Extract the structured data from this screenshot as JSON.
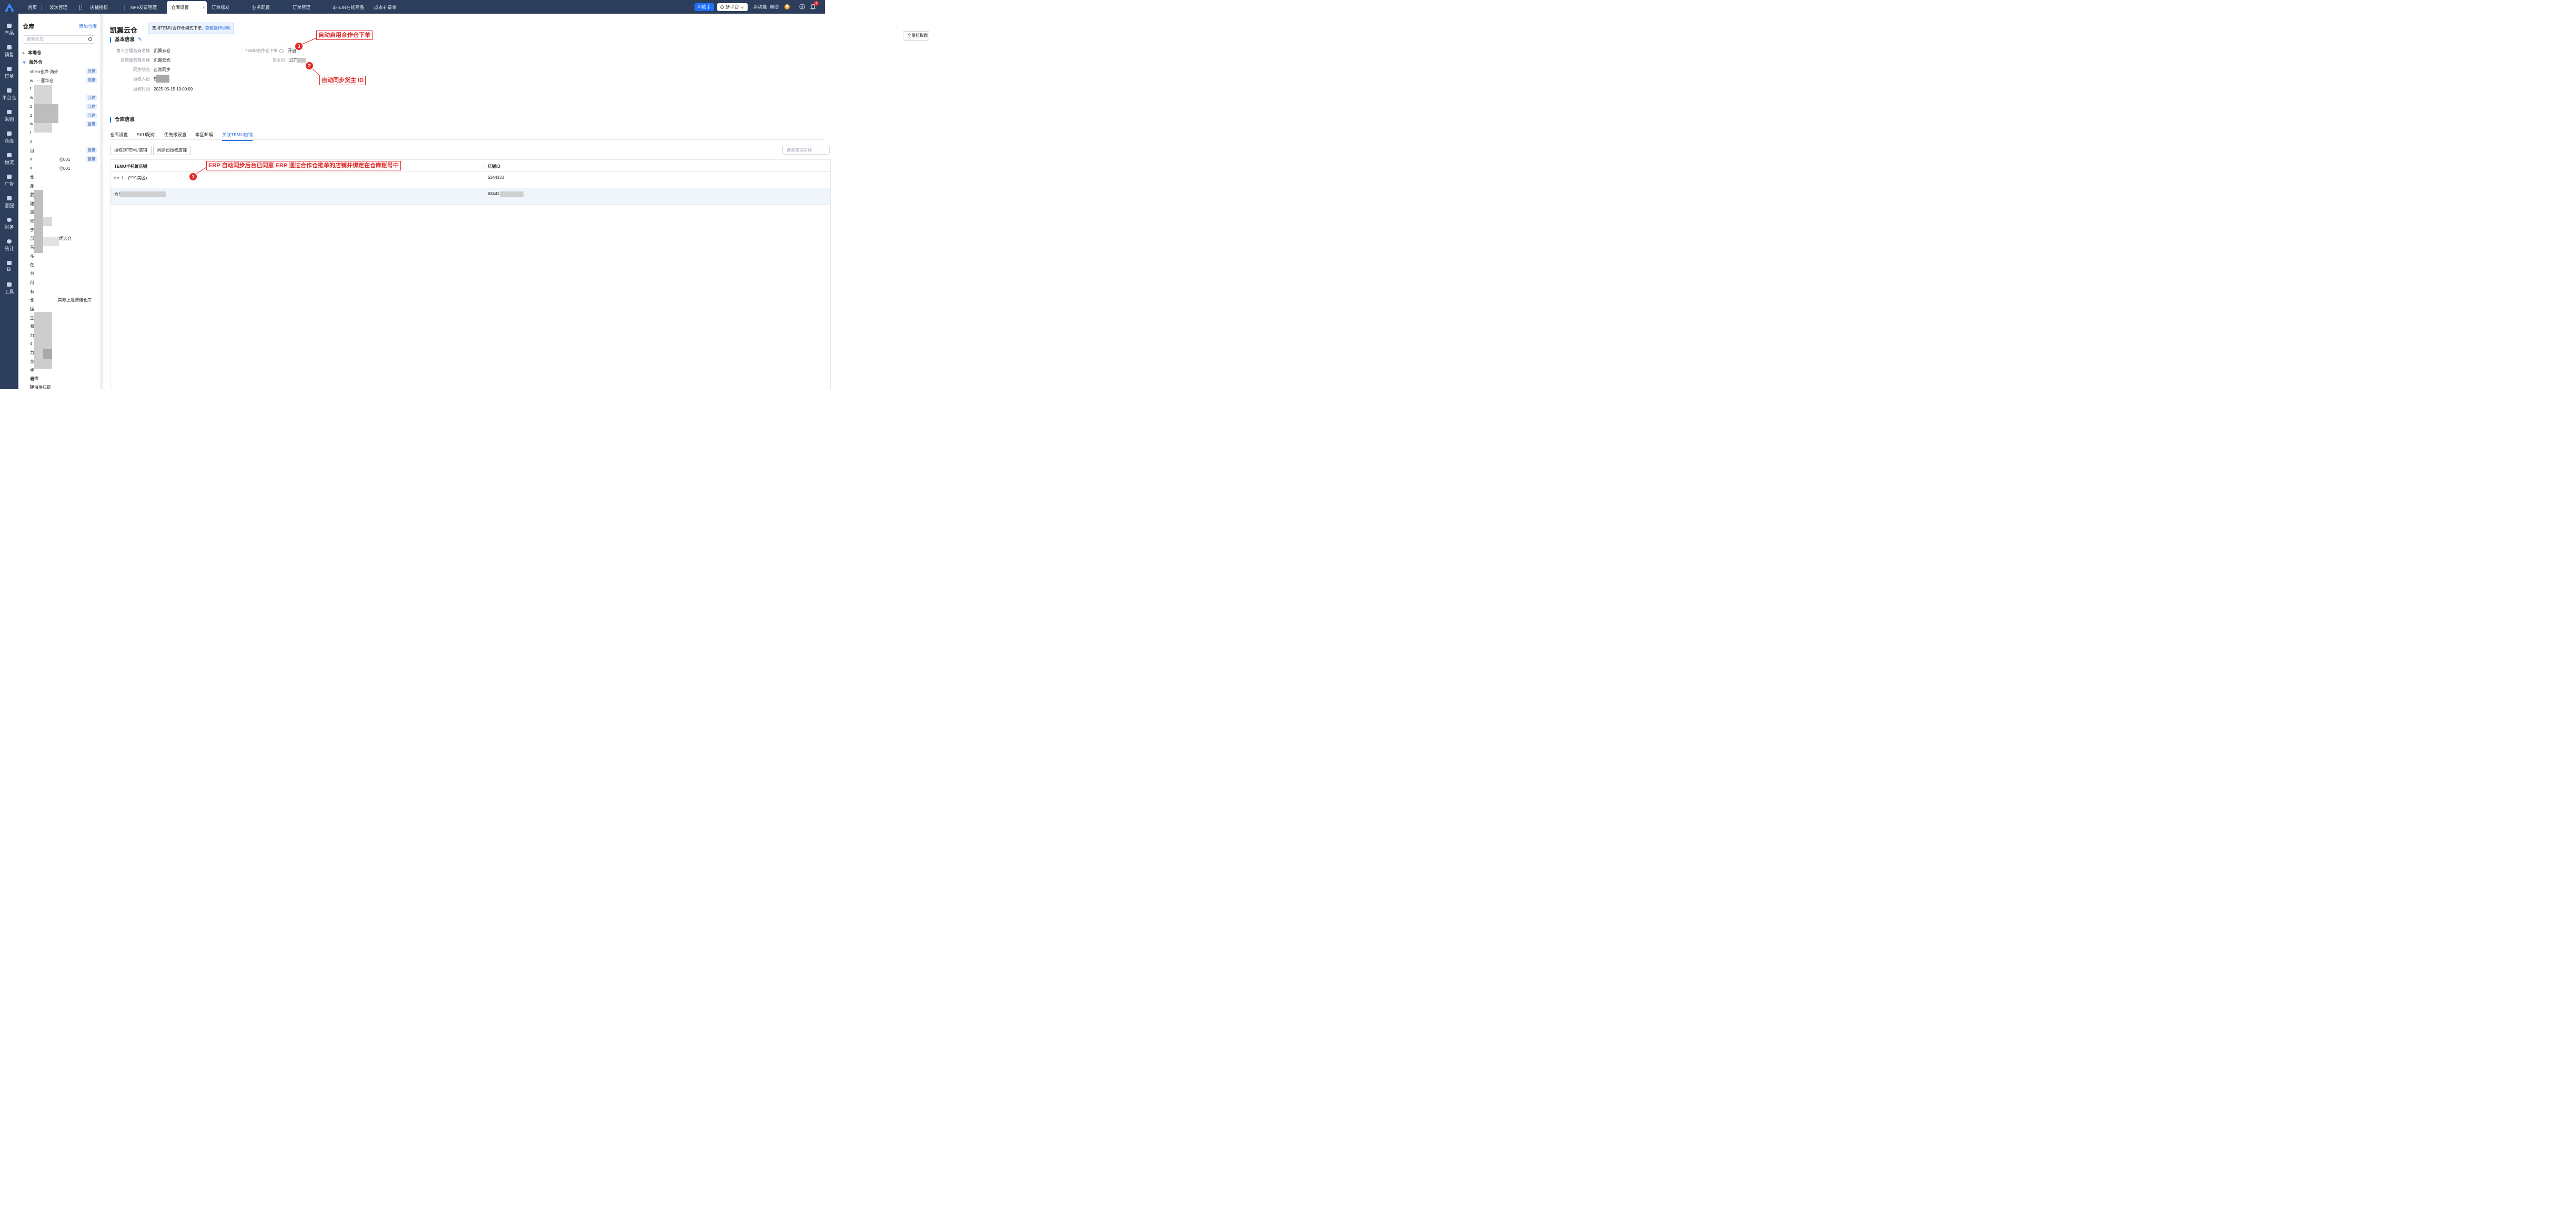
{
  "topbar": {
    "tabs": [
      "首页",
      "波次管理",
      "店铺授权",
      "NFe发票管理",
      "仓库设置",
      "订单标发",
      "业务配置",
      "订单管理",
      "SHEIN在线商品",
      "成本补录单"
    ],
    "active_tab": "仓库设置",
    "close_glyph": "×",
    "ai_label": "AI助手",
    "platform_label": "多平台",
    "new_feature": "新功能",
    "help": "帮助",
    "notify_count": "1",
    "colors": {
      "bar": "#2d3e5c",
      "accent": "#2f73e0",
      "ai_bg": "#1f6fff"
    }
  },
  "sidebar": {
    "items": [
      "产品",
      "销售",
      "订单",
      "平台仓",
      "采购",
      "仓库",
      "物流",
      "广告",
      "客服",
      "财务",
      "统计",
      "BI",
      "工具"
    ]
  },
  "panel": {
    "title": "仓库",
    "add_label": "添加仓库",
    "search_placeholder": "搜索仓库",
    "local_group": "本地仓",
    "overseas_group": "海外仓",
    "self_badge": "自建",
    "rows": [
      "shein仓库-海外",
      "w  · ·  ·亚华仓",
      "t",
      "w",
      "z",
      "z",
      "w",
      "t",
      "z",
      "自",
      "x",
      "x",
      "仓",
      "身",
      "我",
      "建",
      "是",
      "光",
      "于",
      "部",
      "马",
      "多",
      "在",
      "书",
      "何",
      "有",
      "仓",
      "运",
      "生",
      "易",
      "力",
      "4",
      "力",
      "身",
      "手",
      "易",
      "W"
    ],
    "row_suffix_1": "仓001",
    "row_suffix_2": "仓001",
    "row_suffix_3": "优选仓",
    "row_suffix_4": "实际上是赛诺仓库",
    "last_rows": [
      "启德",
      "环海供应链"
    ]
  },
  "main": {
    "title": "凯翼云仓",
    "notice_text": "支持TEMU合作仓模式下单,",
    "notice_link": "查看操作说明",
    "basic_section": "基本信息",
    "fields": {
      "third_party_label": "第三方服务商名称",
      "third_party_value": "凯翼云仓",
      "system_label": "系统服务商名称",
      "system_value": "凯翼云仓",
      "sync_label": "同步状态",
      "sync_value": "正常同步",
      "auth_person_label": "授权人员",
      "auth_person_value": "E",
      "auth_time_label": "授权时间",
      "auth_time_value": "2025-05-15 19:00:09",
      "temu_label": "TEMU合作仓下单",
      "temu_value": "开启",
      "owner_label": "货主ID",
      "owner_value": "1277"
    },
    "warehouse_section": "仓库信息",
    "tabs": [
      "仓库设置",
      "SKU配对",
      "优先级设置",
      "本区邮编",
      "关联TEMU店铺"
    ],
    "active_tab": "关联TEMU店铺",
    "btn_auth": "授权到TEMU店铺",
    "btn_sync": "同步已授权店铺",
    "search_store_placeholder": "搜索店铺名称",
    "top_right_btn": "全量拉取刷",
    "table": {
      "col1": "TEMU半托管店铺",
      "col2": "店铺ID",
      "rows": [
        {
          "store": "tre· l··· ('^'^'-美区)",
          "id": "6344183"
        },
        {
          "store": "合作",
          "id": "63441"
        }
      ]
    }
  },
  "annotations": [
    {
      "num": "1",
      "text": "ERP 自动同步后台已同意 ERP 通过合作仓推单的店铺并绑定在仓库账号中"
    },
    {
      "num": "2",
      "text": "自动同步货主 ID"
    },
    {
      "num": "3",
      "text": "自动启用合作仓下单"
    }
  ]
}
